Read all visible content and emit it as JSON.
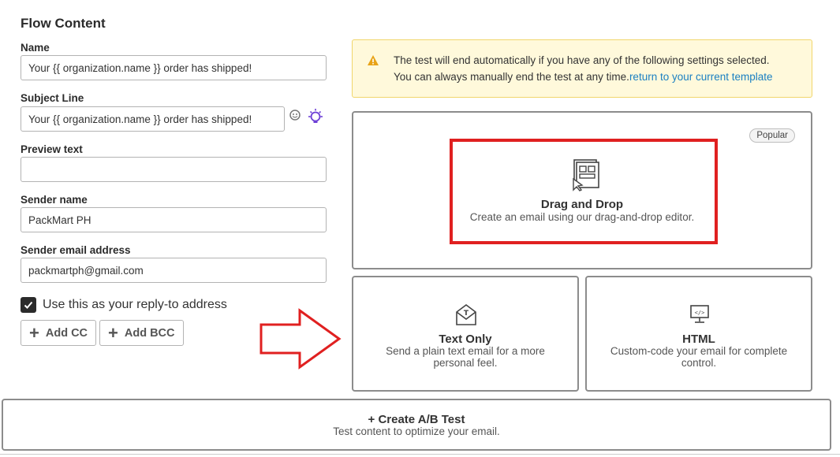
{
  "section": {
    "title": "Flow Content"
  },
  "form": {
    "name": {
      "label": "Name",
      "value": "Your {{ organization.name }} order has shipped!"
    },
    "subject": {
      "label": "Subject Line",
      "value": "Your {{ organization.name }} order has shipped!"
    },
    "preview": {
      "label": "Preview text",
      "value": ""
    },
    "sender_name": {
      "label": "Sender name",
      "value": "PackMart PH"
    },
    "sender_email": {
      "label": "Sender email address",
      "value": "packmartph@gmail.com"
    },
    "reply_to": {
      "label": "Use this as your reply-to address",
      "checked": true
    },
    "add_cc_label": "Add CC",
    "add_bcc_label": "Add BCC"
  },
  "alert": {
    "line1": "The test will end automatically if you have any of the following settings selected.",
    "line2": "You can always manually end the test at any time.",
    "link": "return to your current template"
  },
  "editor_options": {
    "badge": "Popular",
    "drag_drop": {
      "title": "Drag and Drop",
      "desc": "Create an email using our drag-and-drop editor.",
      "icon": "drag-drop-template-icon"
    },
    "text_only": {
      "title": "Text Only",
      "desc": "Send a plain text email for a more personal feel.",
      "icon": "envelope-text-icon"
    },
    "html": {
      "title": "HTML",
      "desc": "Custom-code your email for complete control.",
      "icon": "code-monitor-icon"
    }
  },
  "ab_test": {
    "title": "+ Create A/B Test",
    "desc": "Test content to optimize your email."
  },
  "colors": {
    "annotation_red": "#e02020",
    "link_blue": "#1a7fc2",
    "alert_bg": "#fff9db",
    "bulb_purple": "#6d3fd6"
  }
}
